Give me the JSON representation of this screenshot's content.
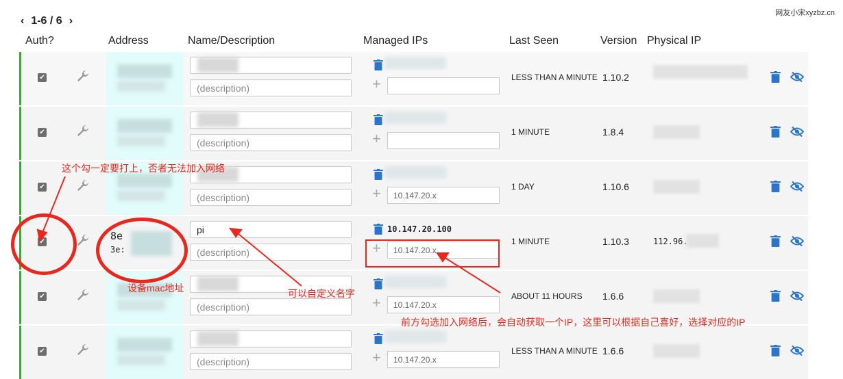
{
  "pager": {
    "prev": "‹",
    "label": "1-6 / 6",
    "next": "›"
  },
  "watermark": "网友小宋xyzbz.cn",
  "headers": {
    "auth": "Auth?",
    "address": "Address",
    "name": "Name/Description",
    "managed": "Managed IPs",
    "lastseen": "Last Seen",
    "version": "Version",
    "physical": "Physical IP"
  },
  "desc_placeholder": "(description)",
  "rows": [
    {
      "lastseen": "LESS THAN A MINUTE",
      "version": "1.10.2",
      "ip_placeholder": ""
    },
    {
      "lastseen": "1 MINUTE",
      "version": "1.8.4",
      "ip_placeholder": ""
    },
    {
      "lastseen": "1 DAY",
      "version": "1.10.6",
      "ip_placeholder": "10.147.20.x"
    },
    {
      "lastseen": "1 MINUTE",
      "version": "1.10.3",
      "ip_placeholder": "10.147.20.x",
      "name": "pi",
      "managed_ip": "10.147.20.100",
      "mac1": "8e",
      "mac2": "3e:",
      "physical": "112.96."
    },
    {
      "lastseen": "ABOUT 11 HOURS",
      "version": "1.6.6",
      "ip_placeholder": "10.147.20.x"
    },
    {
      "lastseen": "LESS THAN A MINUTE",
      "version": "1.6.6",
      "ip_placeholder": "10.147.20.x"
    }
  ],
  "annotations": {
    "check": "这个勾一定要打上，否者无法加入网络",
    "mac": "设备mac地址",
    "name": "可以自定义名字",
    "ip": "前方勾选加入网络后，会自动获取一个IP，这里可以根据自己喜好，选择对应的IP"
  },
  "colors": {
    "accent_green": "#3aaa35",
    "icon_blue": "#2a74c9",
    "annotation_red": "#e8271e"
  }
}
